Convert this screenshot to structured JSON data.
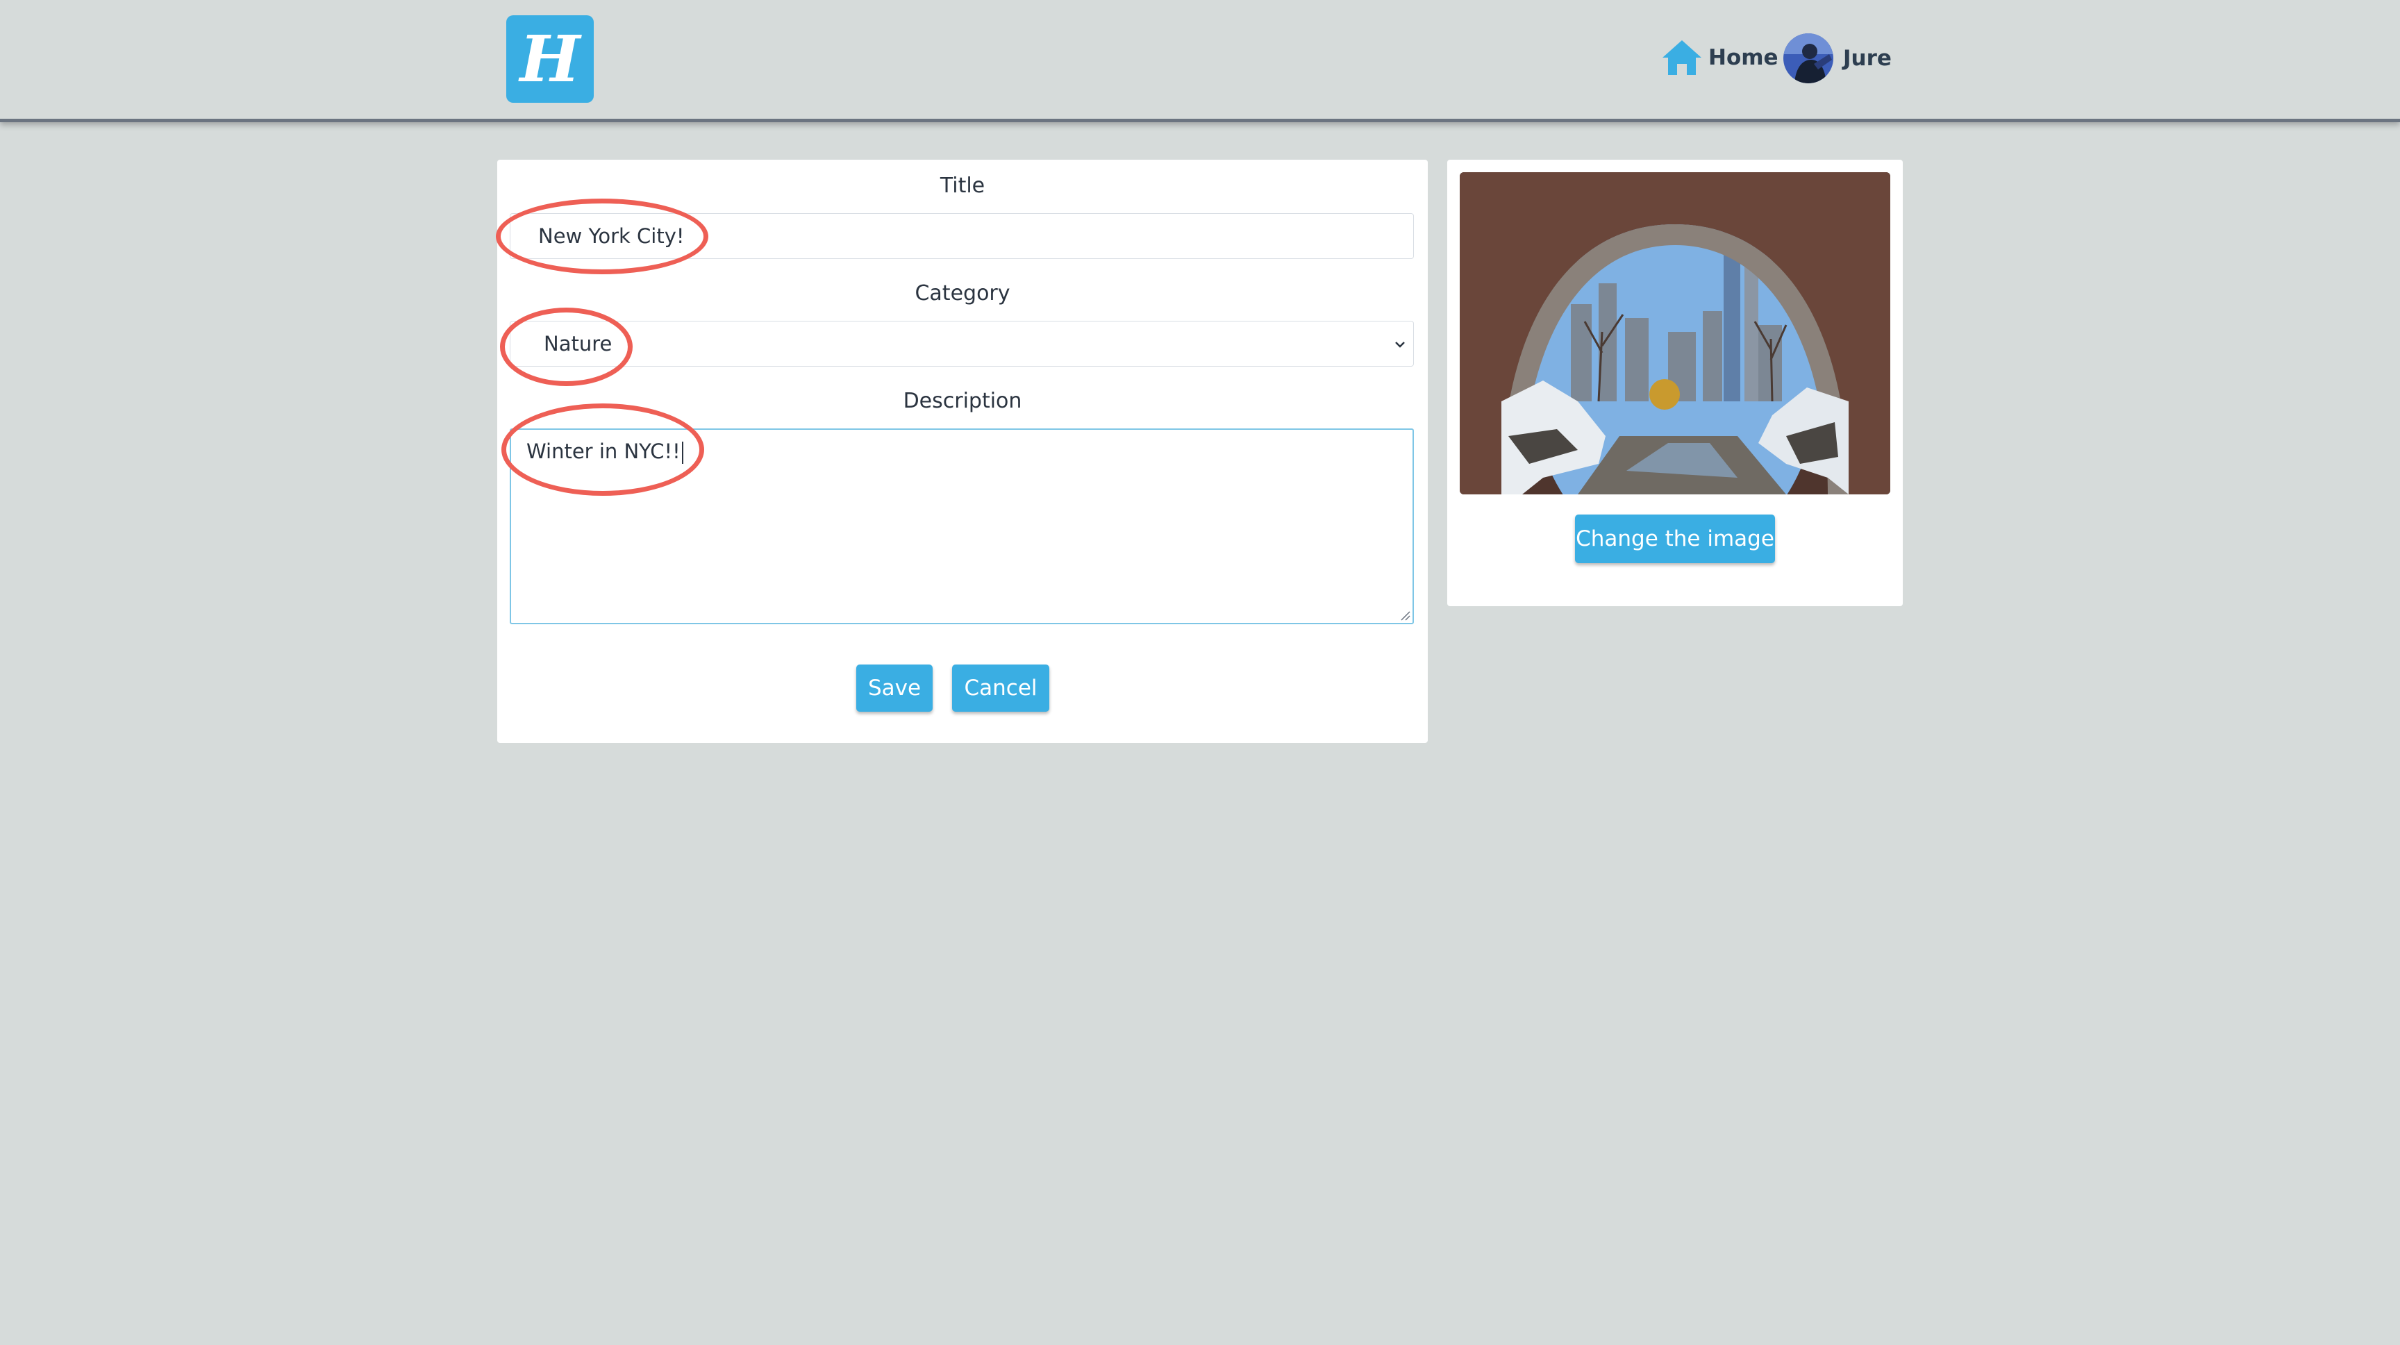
{
  "app": {
    "logo_letter": "H",
    "accent_color": "#3aaee3",
    "annotation_color": "#ee5f55"
  },
  "nav": {
    "home_label": "Home",
    "home_icon": "home-icon",
    "user_name": "Jure",
    "user_avatar": "avatar"
  },
  "form": {
    "title_label": "Title",
    "title_value": "New York City!",
    "category_label": "Category",
    "category_value": "Nature",
    "description_label": "Description",
    "description_value": "Winter in NYC!!",
    "save_label": "Save",
    "cancel_label": "Cancel"
  },
  "image_panel": {
    "change_image_label": "Change the image"
  }
}
